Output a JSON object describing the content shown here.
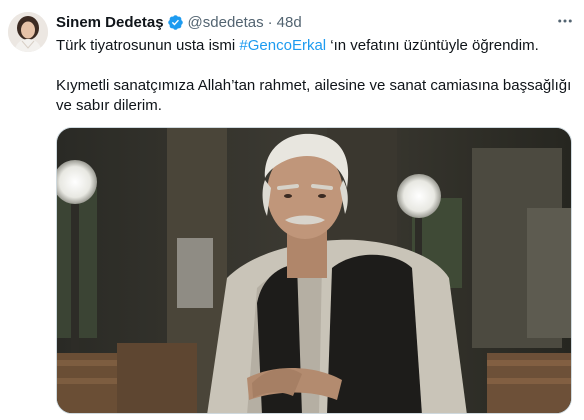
{
  "tweet": {
    "author_name": "Sinem Dedetaş",
    "verified": true,
    "handle": "@sdedetas",
    "separator": "·",
    "time": "48d",
    "text_before_hashtag": "Türk tiyatrosunun usta ismi ",
    "hashtag": "#GencoErkal",
    "text_after_hashtag": " ‘ın vefatını üzüntüyle öğrendim.",
    "paragraph_2": "Kıymetli sanatçımıza Allah’tan rahmet, ailesine ve sanat camiasına başsağlığı ve sabır dilerim."
  },
  "colors": {
    "text": "#0f1419",
    "secondary": "#536471",
    "link": "#1d9bf0",
    "verified_badge": "#1d9bf0"
  },
  "icons": {
    "verified": "verified-badge-icon",
    "more": "more-horizontal-icon"
  }
}
